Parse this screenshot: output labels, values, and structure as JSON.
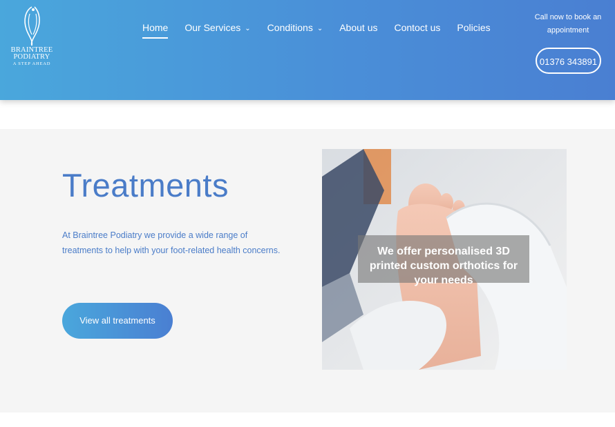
{
  "logo": {
    "name_line1": "BRAINTREE",
    "name_line2": "PODIATRY",
    "tagline": "A STEP AHEAD"
  },
  "nav": {
    "items": [
      {
        "label": "Home"
      },
      {
        "label": "Our Services"
      },
      {
        "label": "Conditions"
      },
      {
        "label": "About us"
      },
      {
        "label": "Contoct us"
      },
      {
        "label": "Policies"
      }
    ]
  },
  "header_cta": {
    "call_text": "Call now to book an appointment",
    "phone": "01376 343891"
  },
  "main": {
    "title": "Treatments",
    "description": "At Braintree Podiatry we provide a wide range of treatments to help with your foot-related health concerns.",
    "button_label": "View all treatments",
    "image_caption": "We offer personalised 3D printed custom orthotics for your needs"
  },
  "colors": {
    "header_gradient_start": "#4aa7dc",
    "header_gradient_end": "#4a7fd2",
    "accent_text": "#4a7cc8",
    "section_bg": "#f5f5f5"
  }
}
